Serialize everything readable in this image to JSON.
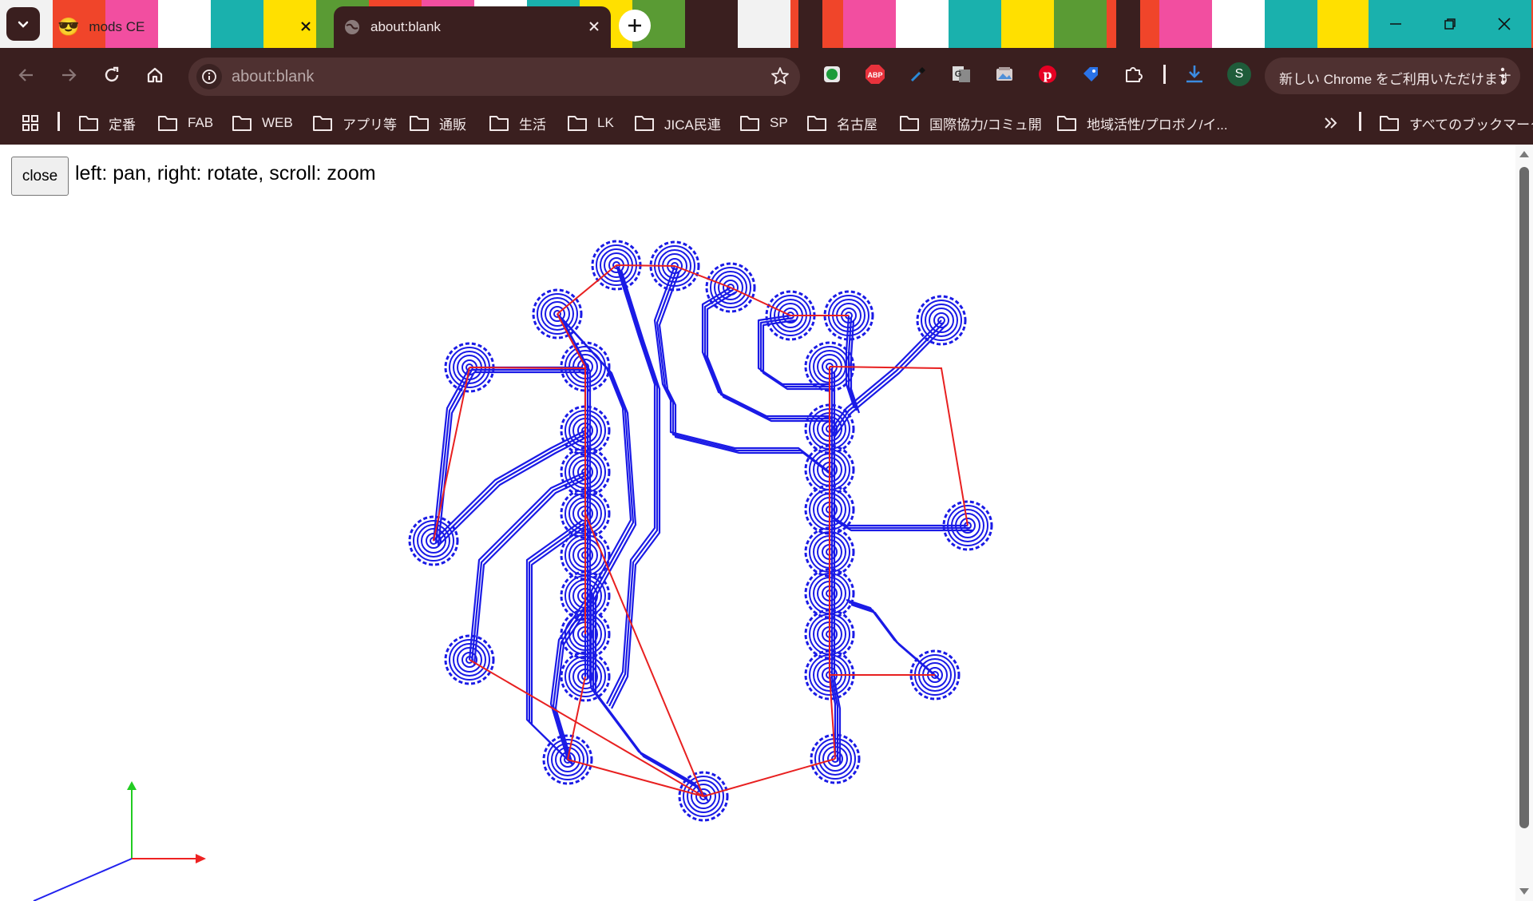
{
  "tabs": [
    {
      "title": "mods CE",
      "icon": "sunglasses-emoji-icon",
      "active": false
    },
    {
      "title": "about:blank",
      "icon": "globe-icon",
      "active": true
    }
  ],
  "address_bar": {
    "url": "about:blank"
  },
  "extensions": [
    "evernote-icon",
    "adblock-plus-icon",
    "eyedropper-icon",
    "google-translate-icon",
    "image-icon",
    "pinterest-icon",
    "tag-icon",
    "puzzle-icon"
  ],
  "profile_initial": "S",
  "promo": "新しい Chrome をご利用いただけます",
  "bookmarks": [
    "定番",
    "FAB",
    "WEB",
    "アプリ等",
    "通販",
    "生活",
    "LK",
    "JICA民連",
    "SP",
    "名古屋",
    "国際協力/コミュ開",
    "地域活性/プロボノ/イ..."
  ],
  "all_bookmarks": "すべてのブックマーク",
  "page": {
    "close_label": "close",
    "hint": "left: pan, right: rotate, scroll: zoom"
  },
  "colors": {
    "toolpath": "#1a1ae6",
    "traverse": "#e82020",
    "frame": "#3a1f1f"
  }
}
